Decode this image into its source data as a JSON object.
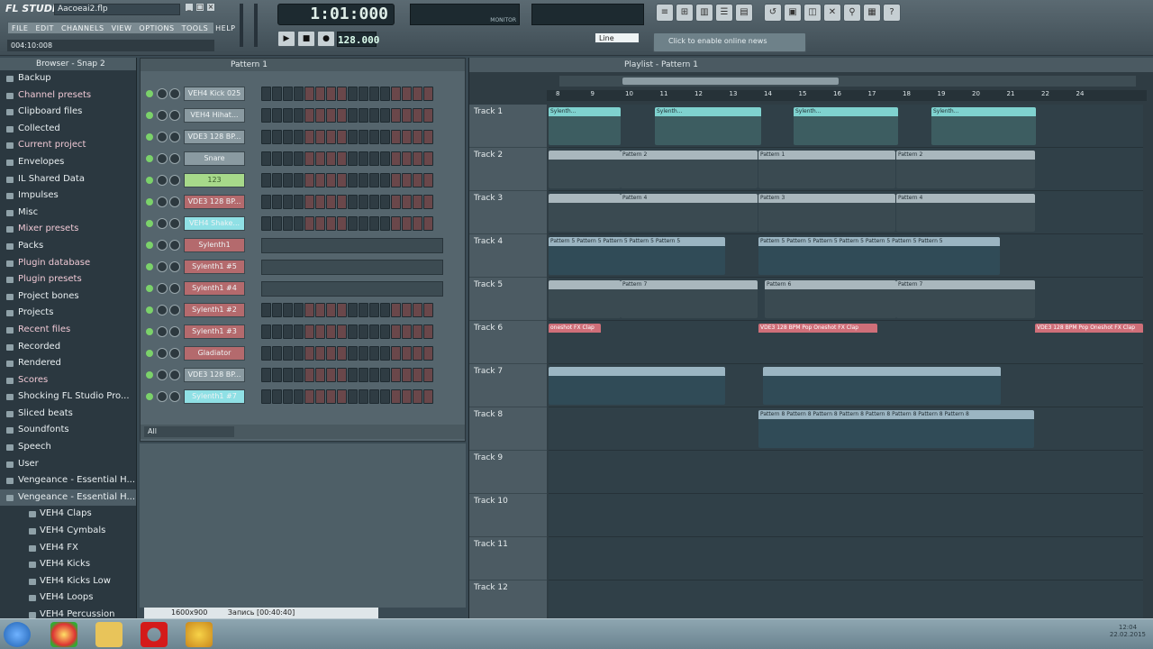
{
  "app": {
    "logo": "FL STUDIO",
    "filename": "Аасоеаі2.flp",
    "time": "004:10:008",
    "menus": [
      "FILE",
      "EDIT",
      "CHANNELS",
      "VIEW",
      "OPTIONS",
      "TOOLS",
      "HELP"
    ],
    "song_time": "1:01:000",
    "bpm": "128.000",
    "snap": "Line",
    "hint": "Click to enable online news",
    "monitor_label": "MONITOR"
  },
  "browser": {
    "title": "Browser - Snap 2",
    "items": [
      {
        "label": "Backup",
        "hl": false
      },
      {
        "label": "Channel presets",
        "hl": true
      },
      {
        "label": "Clipboard files",
        "hl": false
      },
      {
        "label": "Collected",
        "hl": false
      },
      {
        "label": "Current project",
        "hl": true
      },
      {
        "label": "Envelopes",
        "hl": false
      },
      {
        "label": "IL Shared Data",
        "hl": false
      },
      {
        "label": "Impulses",
        "hl": false
      },
      {
        "label": "Misc",
        "hl": false
      },
      {
        "label": "Mixer presets",
        "hl": true
      },
      {
        "label": "Packs",
        "hl": false
      },
      {
        "label": "Plugin database",
        "hl": true
      },
      {
        "label": "Plugin presets",
        "hl": true
      },
      {
        "label": "Project bones",
        "hl": false
      },
      {
        "label": "Projects",
        "hl": false
      },
      {
        "label": "Recent files",
        "hl": true
      },
      {
        "label": "Recorded",
        "hl": false
      },
      {
        "label": "Rendered",
        "hl": false
      },
      {
        "label": "Scores",
        "hl": true
      },
      {
        "label": "Shocking FL Studio Pro...",
        "hl": false
      },
      {
        "label": "Sliced beats",
        "hl": false
      },
      {
        "label": "Soundfonts",
        "hl": false
      },
      {
        "label": "Speech",
        "hl": false
      },
      {
        "label": "User",
        "hl": false
      },
      {
        "label": "Vengeance - Essential H...",
        "hl": false
      },
      {
        "label": "Vengeance - Essential H...",
        "hl": false,
        "sel": true
      },
      {
        "label": "VEH4 Claps",
        "hl": false,
        "sub": true
      },
      {
        "label": "VEH4 Cymbals",
        "hl": false,
        "sub": true
      },
      {
        "label": "VEH4 FX",
        "hl": false,
        "sub": true
      },
      {
        "label": "VEH4 Kicks",
        "hl": false,
        "sub": true
      },
      {
        "label": "VEH4 Kicks Low",
        "hl": false,
        "sub": true
      },
      {
        "label": "VEH4 Loops",
        "hl": false,
        "sub": true
      },
      {
        "label": "VEH4 Percussion",
        "hl": false,
        "sub": true
      }
    ]
  },
  "rack": {
    "title": "Pattern 1",
    "filter": "All",
    "channels": [
      {
        "name": "VEH4 Kick 025",
        "style": "gray",
        "roll": false
      },
      {
        "name": "VEH4 Hihat...",
        "style": "gray",
        "roll": false
      },
      {
        "name": "VDE3 128 BP...",
        "style": "gray",
        "roll": false
      },
      {
        "name": "Snare",
        "style": "gray",
        "roll": false
      },
      {
        "name": "123",
        "style": "green",
        "roll": false
      },
      {
        "name": "VDE3 128 BP...",
        "style": "red",
        "roll": false
      },
      {
        "name": "VEH4 Shake...",
        "style": "cyan",
        "roll": false
      },
      {
        "name": "Sylenth1",
        "style": "red",
        "roll": true
      },
      {
        "name": "Sylenth1 #5",
        "style": "red",
        "roll": true
      },
      {
        "name": "Sylenth1 #4",
        "style": "red",
        "roll": true
      },
      {
        "name": "Sylenth1 #2",
        "style": "red",
        "roll": false
      },
      {
        "name": "Sylenth1 #3",
        "style": "red",
        "roll": false
      },
      {
        "name": "Gladiator",
        "style": "red",
        "roll": false
      },
      {
        "name": "VDE3 128 BP...",
        "style": "gray",
        "roll": false
      },
      {
        "name": "Sylenth1 #7",
        "style": "cyan",
        "roll": false
      }
    ]
  },
  "playlist": {
    "title": "Playlist - Pattern 1",
    "bars": [
      "8",
      "9",
      "10",
      "11",
      "12",
      "13",
      "14",
      "15",
      "16",
      "17",
      "18",
      "19",
      "20",
      "21",
      "22",
      "24"
    ],
    "tracks": [
      {
        "name": "Track 1",
        "clips": [
          {
            "s": 0,
            "w": 80,
            "t": "Sylenth...",
            "c": "teal"
          },
          {
            "s": 118,
            "w": 118,
            "t": "Sylenth...",
            "c": "teal"
          },
          {
            "s": 272,
            "w": 116,
            "t": "Sylenth...",
            "c": "teal"
          },
          {
            "s": 425,
            "w": 116,
            "t": "Sylenth...",
            "c": "teal"
          }
        ]
      },
      {
        "name": "Track 2",
        "clips": [
          {
            "s": 0,
            "w": 80,
            "t": "",
            "c": "gray"
          },
          {
            "s": 80,
            "w": 152,
            "t": "Pattern 2",
            "c": "gray"
          },
          {
            "s": 233,
            "w": 152,
            "t": "Pattern 1",
            "c": "gray"
          },
          {
            "s": 386,
            "w": 154,
            "t": "Pattern 2",
            "c": "gray"
          }
        ]
      },
      {
        "name": "Track 3",
        "clips": [
          {
            "s": 0,
            "w": 80,
            "t": "",
            "c": "gray"
          },
          {
            "s": 80,
            "w": 152,
            "t": "Pattern 4",
            "c": "gray"
          },
          {
            "s": 233,
            "w": 152,
            "t": "Pattern 3",
            "c": "gray"
          },
          {
            "s": 386,
            "w": 154,
            "t": "Pattern 4",
            "c": "gray"
          }
        ]
      },
      {
        "name": "Track 4",
        "clips": [
          {
            "s": 0,
            "w": 196,
            "t": "Pattern 5  Pattern 5  Pattern 5  Pattern 5  Pattern 5",
            "c": "blue"
          },
          {
            "s": 233,
            "w": 268,
            "t": "Pattern 5  Pattern 5  Pattern 5  Pattern 5  Pattern 5  Pattern 5  Pattern 5",
            "c": "blue"
          }
        ]
      },
      {
        "name": "Track 5",
        "clips": [
          {
            "s": 0,
            "w": 80,
            "t": "",
            "c": "gray"
          },
          {
            "s": 80,
            "w": 152,
            "t": "Pattern 7",
            "c": "gray"
          },
          {
            "s": 240,
            "w": 146,
            "t": "Pattern 6",
            "c": "gray"
          },
          {
            "s": 386,
            "w": 154,
            "t": "Pattern 7",
            "c": "gray"
          }
        ]
      },
      {
        "name": "Track 6",
        "clips": [
          {
            "s": 0,
            "w": 58,
            "t": "oneshot FX Clap",
            "c": "red"
          },
          {
            "s": 233,
            "w": 132,
            "t": "VDE3 128 BPM Pop Oneshot FX Clap",
            "c": "red"
          },
          {
            "s": 540,
            "w": 120,
            "t": "VDE3 128 BPM Pop Oneshot FX Clap",
            "c": "red"
          }
        ]
      },
      {
        "name": "Track 7",
        "clips": [
          {
            "s": 0,
            "w": 196,
            "t": "",
            "c": "blue"
          },
          {
            "s": 238,
            "w": 264,
            "t": "",
            "c": "blue"
          }
        ]
      },
      {
        "name": "Track 8",
        "clips": [
          {
            "s": 233,
            "w": 306,
            "t": "Pattern 8  Pattern 8  Pattern 8  Pattern 8  Pattern 8  Pattern 8  Pattern 8  Pattern 8",
            "c": "blue"
          }
        ]
      },
      {
        "name": "Track 9",
        "clips": []
      },
      {
        "name": "Track 10",
        "clips": []
      },
      {
        "name": "Track 11",
        "clips": []
      },
      {
        "name": "Track 12",
        "clips": []
      }
    ]
  },
  "recording": {
    "resolution": "1600x900",
    "label": "Запись [00:40:40]"
  },
  "tray": {
    "time": "12:04",
    "date": "22.02.2015"
  }
}
